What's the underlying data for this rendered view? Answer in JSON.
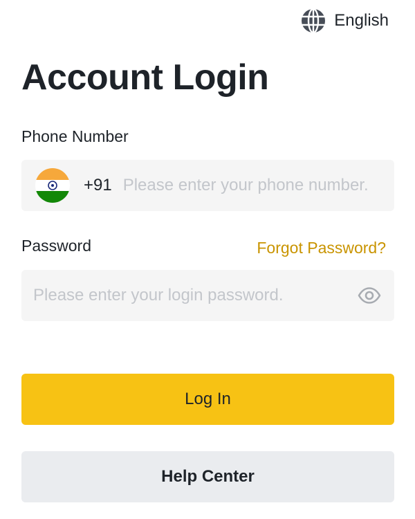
{
  "header": {
    "language": "English",
    "language_icon": "globe-icon"
  },
  "title": "Account Login",
  "phone": {
    "label": "Phone Number",
    "country_flag": "india-flag-icon",
    "country_code": "+91",
    "value": "",
    "placeholder": "Please enter your phone number."
  },
  "password": {
    "label": "Password",
    "forgot_label": "Forgot Password?",
    "value": "",
    "placeholder": "Please enter your login password.",
    "toggle_icon": "eye-icon"
  },
  "buttons": {
    "login_label": "Log In",
    "help_label": "Help Center"
  },
  "colors": {
    "primary": "#f7c214",
    "link": "#c99400",
    "text": "#1e2329",
    "input_bg": "#f5f5f5",
    "secondary_button_bg": "#eaecef",
    "placeholder": "#c3c6cb"
  }
}
